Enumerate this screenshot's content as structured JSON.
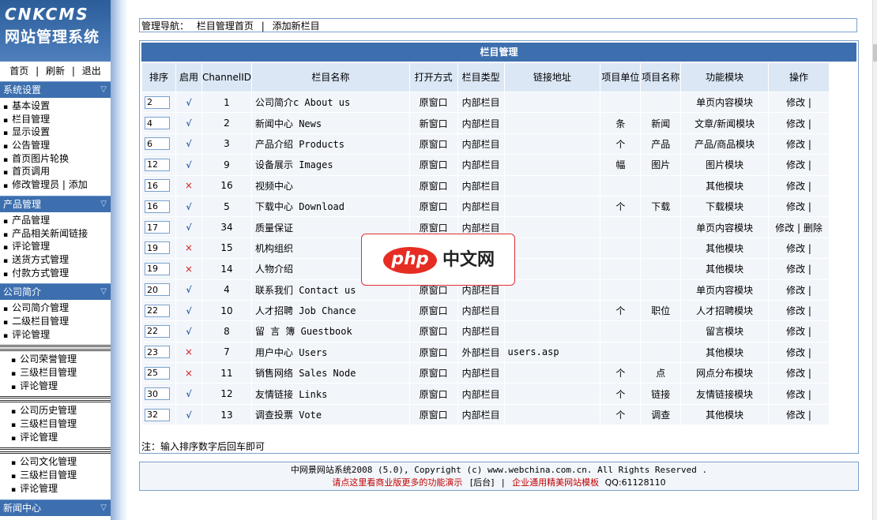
{
  "logo": {
    "line1": "CNKCMS",
    "line2": "网站管理系统"
  },
  "toplinks": {
    "home": "首页",
    "refresh": "刷新",
    "logout": "退出",
    "sep": "|"
  },
  "sections": [
    {
      "title": "系统设置",
      "items": [
        "基本设置",
        "栏目管理",
        "显示设置",
        "公告管理",
        "首页图片轮换",
        "首页调用",
        "修改管理员 | 添加"
      ]
    },
    {
      "title": "产品管理",
      "items": [
        "产品管理",
        "产品相关新闻链接",
        "评论管理",
        "送货方式管理",
        "付款方式管理"
      ]
    },
    {
      "title": "公司简介",
      "items": [
        "公司简介管理",
        "二级栏目管理",
        "评论管理"
      ],
      "groups": [
        [
          "公司荣誉管理",
          "三级栏目管理",
          "评论管理"
        ],
        [
          "公司历史管理",
          "三级栏目管理",
          "评论管理"
        ],
        [
          "公司文化管理",
          "三级栏目管理",
          "评论管理"
        ]
      ]
    },
    {
      "title": "新闻中心"
    }
  ],
  "bullet": "▪",
  "collapse_arrow": "▽",
  "nav": {
    "label": "管理导航：",
    "home": "栏目管理首页",
    "sep": "|",
    "add": "添加新栏目"
  },
  "panel": {
    "title": "栏目管理"
  },
  "table": {
    "headers": [
      "排序",
      "启用",
      "ChannelID",
      "栏目名称",
      "打开方式",
      "栏目类型",
      "链接地址",
      "项目单位",
      "项目名称",
      "功能模块",
      "操作"
    ],
    "rows": [
      {
        "order": "2",
        "enabled": true,
        "id": "1",
        "name": "公司简介c About us",
        "open": "原窗口",
        "type": "内部栏目",
        "link": "",
        "unit": "",
        "item": "",
        "module": "单页内容模块",
        "ops": "修改 |"
      },
      {
        "order": "4",
        "enabled": true,
        "id": "2",
        "name": "新闻中心 News",
        "open": "新窗口",
        "type": "内部栏目",
        "link": "",
        "unit": "条",
        "item": "新闻",
        "module": "文章/新闻模块",
        "ops": "修改 |"
      },
      {
        "order": "6",
        "enabled": true,
        "id": "3",
        "name": "产品介绍 Products",
        "open": "原窗口",
        "type": "内部栏目",
        "link": "",
        "unit": "个",
        "item": "产品",
        "module": "产品/商品模块",
        "ops": "修改 |"
      },
      {
        "order": "12",
        "enabled": true,
        "id": "9",
        "name": "设备展示 Images",
        "open": "原窗口",
        "type": "内部栏目",
        "link": "",
        "unit": "幅",
        "item": "图片",
        "module": "图片模块",
        "ops": "修改 |"
      },
      {
        "order": "16",
        "enabled": false,
        "id": "16",
        "name": "视频中心",
        "open": "原窗口",
        "type": "内部栏目",
        "link": "",
        "unit": "",
        "item": "",
        "module": "其他模块",
        "ops": "修改 |"
      },
      {
        "order": "16",
        "enabled": true,
        "id": "5",
        "name": "下载中心 Download",
        "open": "原窗口",
        "type": "内部栏目",
        "link": "",
        "unit": "个",
        "item": "下载",
        "module": "下载模块",
        "ops": "修改 |"
      },
      {
        "order": "17",
        "enabled": true,
        "id": "34",
        "name": "质量保证",
        "open": "原窗口",
        "type": "内部栏目",
        "link": "",
        "unit": "",
        "item": "",
        "module": "单页内容模块",
        "ops": "修改 | 删除"
      },
      {
        "order": "19",
        "enabled": false,
        "id": "15",
        "name": "机构组织",
        "open": "",
        "type": "",
        "link": "",
        "unit": "",
        "item": "",
        "module": "其他模块",
        "ops": "修改 |"
      },
      {
        "order": "19",
        "enabled": false,
        "id": "14",
        "name": "人物介绍",
        "open": "",
        "type": "",
        "link": "",
        "unit": "",
        "item": "",
        "module": "其他模块",
        "ops": "修改 |"
      },
      {
        "order": "20",
        "enabled": true,
        "id": "4",
        "name": "联系我们 Contact us",
        "open": "原窗口",
        "type": "内部栏目",
        "link": "",
        "unit": "",
        "item": "",
        "module": "单页内容模块",
        "ops": "修改 |"
      },
      {
        "order": "22",
        "enabled": true,
        "id": "10",
        "name": "人才招聘 Job Chance",
        "open": "原窗口",
        "type": "内部栏目",
        "link": "",
        "unit": "个",
        "item": "职位",
        "module": "人才招聘模块",
        "ops": "修改 |"
      },
      {
        "order": "22",
        "enabled": true,
        "id": "8",
        "name": "留 言 簿 Guestbook",
        "open": "原窗口",
        "type": "内部栏目",
        "link": "",
        "unit": "",
        "item": "",
        "module": "留言模块",
        "ops": "修改 |"
      },
      {
        "order": "23",
        "enabled": false,
        "id": "7",
        "name": "用户中心 Users",
        "open": "原窗口",
        "type": "外部栏目",
        "link": "users.asp",
        "unit": "",
        "item": "",
        "module": "其他模块",
        "ops": "修改 |"
      },
      {
        "order": "25",
        "enabled": false,
        "id": "11",
        "name": "销售网络 Sales Node",
        "open": "原窗口",
        "type": "内部栏目",
        "link": "",
        "unit": "个",
        "item": "点",
        "module": "网点分布模块",
        "ops": "修改 |"
      },
      {
        "order": "30",
        "enabled": true,
        "id": "12",
        "name": "友情链接 Links",
        "open": "原窗口",
        "type": "内部栏目",
        "link": "",
        "unit": "个",
        "item": "链接",
        "module": "友情链接模块",
        "ops": "修改 |"
      },
      {
        "order": "32",
        "enabled": true,
        "id": "13",
        "name": "调查投票 Vote",
        "open": "原窗口",
        "type": "内部栏目",
        "link": "",
        "unit": "个",
        "item": "调查",
        "module": "其他模块",
        "ops": "修改 |"
      }
    ],
    "enabled_mark": "√",
    "disabled_mark": "×"
  },
  "note": "注：输入排序数字后回车即可",
  "footer": {
    "line1": "中网景网站系统2008 (5.0), Copyright (c) www.webchina.com.cn. All Rights Reserved .",
    "demo": "请点这里看商业版更多的功能演示",
    "backend": "[后台]",
    "sep": "|",
    "template": "企业通用精美网站模板",
    "qq": "QQ:61128110"
  },
  "overlay": {
    "logo_text": "php",
    "site": "中文网"
  },
  "colors": {
    "header_blue": "#3d6fae",
    "cell_bg": "#f2f6fb",
    "border": "#7aa0cc",
    "red": "#c00000"
  }
}
